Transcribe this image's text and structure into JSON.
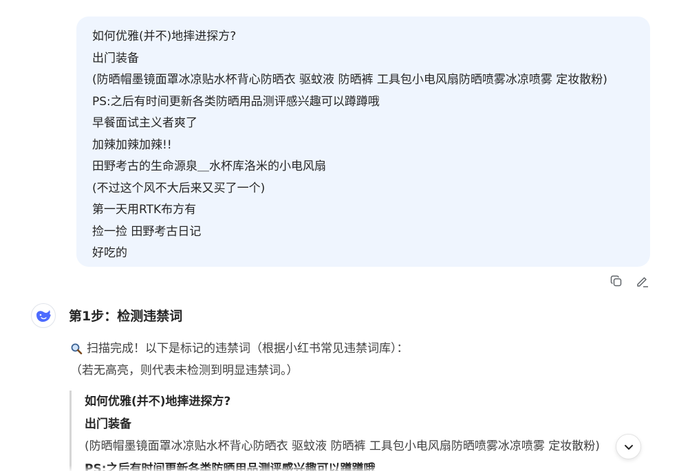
{
  "user_message": {
    "lines": [
      "如何优雅(并不)地摔进探方?",
      "出门装备",
      "(防晒帽墨镜面罩冰凉贴水杯背心防晒衣 驱蚊液 防晒裤 工具包小电风扇防晒喷雾冰凉喷雾 定妆散粉)",
      "PS:之后有时间更新各类防晒用品测评感兴趣可以蹲蹲哦",
      "早餐面试主义者爽了",
      "加辣加辣加辣!!",
      "田野考古的生命源泉＿水杯库洛米的小电风扇",
      "(不过这个风不大后来又买了一个)",
      "第一天用RTK布方有",
      "捡一捡 田野考古日记",
      "好吃的"
    ],
    "actions": {
      "copy_icon": "copy-icon",
      "edit_icon": "edit-icon"
    }
  },
  "assistant": {
    "avatar_icon": "whale-logo-icon",
    "step_title": "第1步：检测违禁词",
    "scan_icon": "magnifier-icon",
    "scan_text": "扫描完成！以下是标记的违禁词（根据小红书常见违禁词库）：",
    "note_text": "（若无高亮，则代表未检测到明显违禁词。）",
    "quote_lines": [
      {
        "text": "如何优雅(并不)地摔进探方?",
        "bold": true
      },
      {
        "text": "出门装备",
        "bold": true
      },
      {
        "text": "(防晒帽墨镜面罩冰凉贴水杯背心防晒衣 驱蚊液 防晒裤 工具包小电风扇防晒喷雾冰凉喷雾 定妆散粉)",
        "bold": false
      },
      {
        "text": "PS:之后有时间更新各类防晒用品测评感兴趣可以蹲蹲哦",
        "bold": true
      }
    ]
  },
  "scroll_button": {
    "icon": "chevron-down-icon"
  },
  "colors": {
    "bubble_bg": "#eff5fe",
    "brand_blue": "#4d6bfe",
    "text": "#262626"
  }
}
